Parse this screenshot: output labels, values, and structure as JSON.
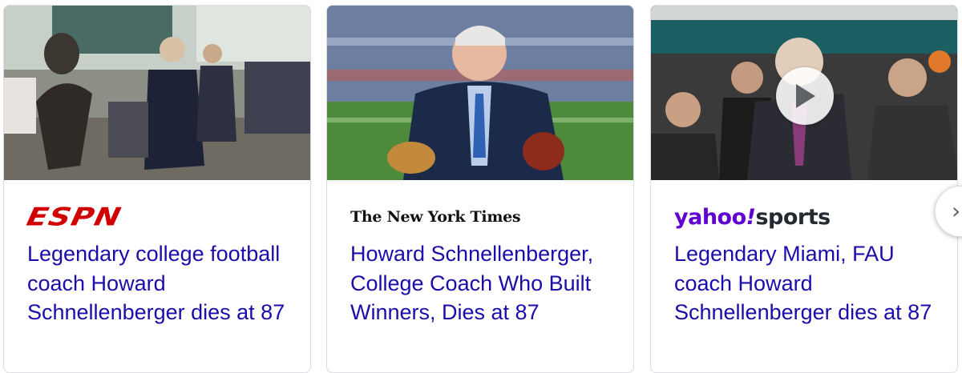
{
  "cards": [
    {
      "source": "ESPN",
      "source_logo_text": "ESPN",
      "headline": "Legendary college football coach Howard Schnellenberger dies at 87",
      "thumbnail_icon": "photo-thumbnail",
      "is_video": false
    },
    {
      "source": "The New York Times",
      "source_logo_text": "The New York Times",
      "headline": "Howard Schnellenberger, College Coach Who Built Winners, Dies at 87",
      "thumbnail_icon": "photo-thumbnail",
      "is_video": false
    },
    {
      "source": "Yahoo Sports",
      "source_logo_parts": [
        "yahoo",
        "!",
        "sports"
      ],
      "headline": "Legendary Miami, FAU coach Howard Schnellenberger dies at 87",
      "thumbnail_icon": "video-thumbnail",
      "is_video": true,
      "play_icon": "play-icon"
    }
  ],
  "carousel": {
    "next_icon": "chevron-right-icon",
    "next_glyph": "›"
  },
  "colors": {
    "headline_link": "#1a0dab",
    "espn_red": "#d00000",
    "yahoo_purple": "#6001d2",
    "card_border": "#dadce0"
  }
}
